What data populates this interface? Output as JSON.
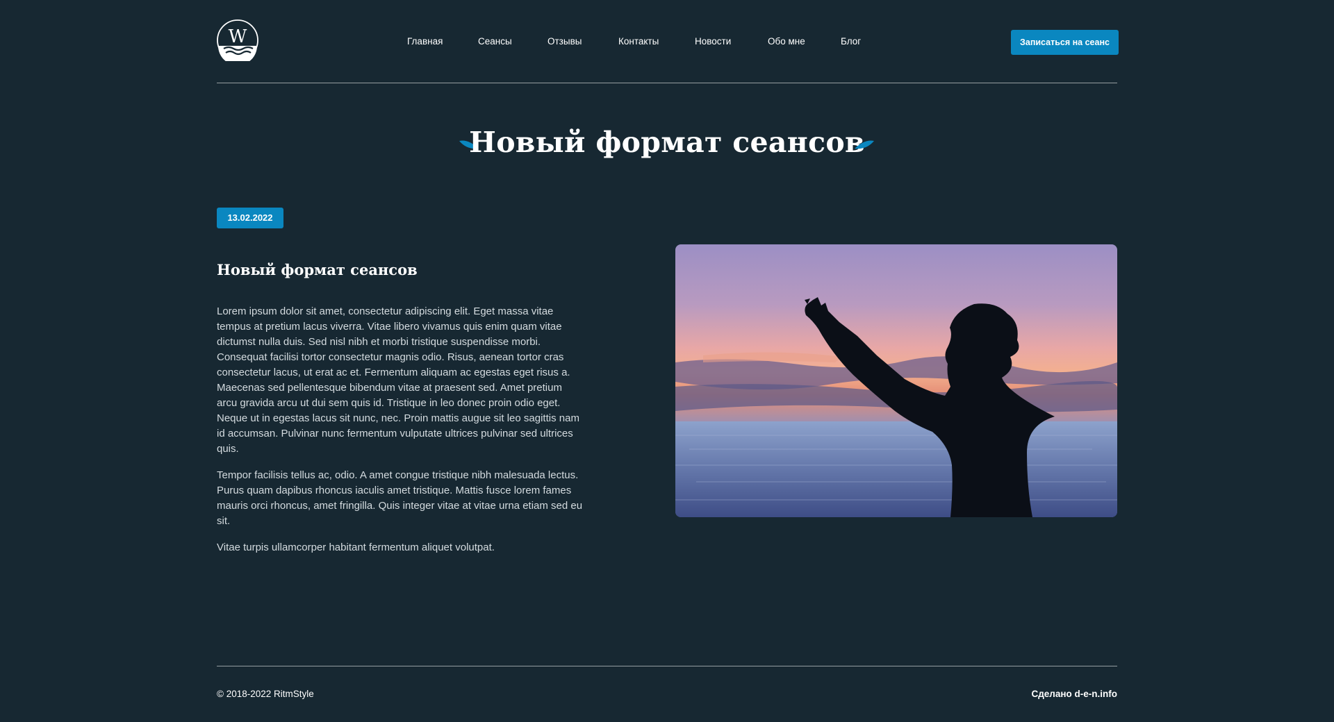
{
  "header": {
    "logo_letter": "W",
    "nav": [
      {
        "label": "Главная"
      },
      {
        "label": "Сеансы"
      },
      {
        "label": "Отзывы"
      },
      {
        "label": "Контакты"
      },
      {
        "label": "Новости"
      },
      {
        "label": "Обо мне"
      },
      {
        "label": "Блог"
      }
    ],
    "cta_label": "Записаться на сеанс"
  },
  "hero": {
    "title": "Новый формат сеансов"
  },
  "article": {
    "date": "13.02.2022",
    "title": "Новый формат сеансов",
    "paragraphs": [
      "Lorem ipsum dolor sit amet, consectetur adipiscing elit. Eget massa vitae tempus at pretium lacus viverra. Vitae libero vivamus quis enim quam vitae dictumst nulla duis. Sed nisl nibh et morbi tristique suspendisse morbi. Consequat facilisi tortor consectetur magnis odio. Risus, aenean tortor cras consectetur lacus, ut erat ac et. Fermentum aliquam ac egestas eget risus a. Maecenas sed pellentesque bibendum vitae at praesent sed. Amet pretium arcu gravida arcu ut dui sem quis id. Tristique in leo donec proin odio eget. Neque ut in egestas lacus sit nunc, nec. Proin mattis augue sit leo sagittis nam id accumsan. Pulvinar nunc fermentum vulputate ultrices pulvinar sed ultrices quis.",
      "Tempor facilisis tellus ac, odio. A amet congue tristique nibh malesuada lectus. Purus quam dapibus rhoncus iaculis amet tristique. Mattis fusce lorem fames mauris orci rhoncus, amet fringilla. Quis integer vitae at vitae urna etiam sed eu sit.",
      "Vitae turpis ullamcorper habitant fermentum aliquet volutpat."
    ]
  },
  "footer": {
    "copyright": "© 2018-2022 RitmStyle",
    "made_by": "Сделано d-e-n.info"
  },
  "colors": {
    "background": "#172832",
    "accent": "#0a87c0",
    "text": "#ffffff",
    "body_text": "#d4dbdf"
  },
  "icons": {
    "logo": "w-waves-logo-icon",
    "title_decoration": "leaf-icon"
  }
}
